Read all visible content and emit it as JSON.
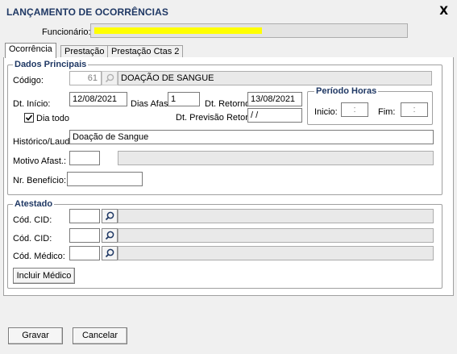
{
  "window": {
    "title": "LANÇAMENTO DE OCORRÊNCIAS",
    "close_label": "X"
  },
  "header": {
    "funcionario_label": "Funcionário:",
    "funcionario_value": ""
  },
  "tabs": [
    {
      "label": "Ocorrência",
      "active": true
    },
    {
      "label": "Prestação Ctas",
      "active": false
    },
    {
      "label": "Prestação Ctas 2",
      "active": false
    }
  ],
  "dados_principais": {
    "title": "Dados Principais",
    "codigo_label": "Código:",
    "codigo_value": "61",
    "codigo_desc": "DOAÇÃO DE SANGUE",
    "dt_inicio_label": "Dt. Início:",
    "dt_inicio_value": "12/08/2021",
    "dias_afast_label": "Dias Afast.",
    "dias_afast_value": "1",
    "dt_retorno_label": "Dt. Retorno:",
    "dt_retorno_value": "13/08/2021",
    "dia_todo_label": "Dia todo",
    "dia_todo_checked": true,
    "dt_prev_retorno_label": "Dt. Previsão Retorno:",
    "dt_prev_retorno_value": " / /",
    "historico_label": "Histórico/Laudo:",
    "historico_value": "Doação de Sangue",
    "motivo_label": "Motivo Afast.:",
    "motivo_value": "",
    "motivo_desc": "",
    "nr_beneficio_label": "Nr. Benefício:",
    "nr_beneficio_value": ""
  },
  "periodo_horas": {
    "title": "Período Horas",
    "inicio_label": "Inicio:",
    "inicio_value": ":",
    "fim_label": "Fim:",
    "fim_value": ":"
  },
  "atestado": {
    "title": "Atestado",
    "cid1_label": "Cód. CID:",
    "cid2_label": "Cód. CID:",
    "medico_label": "Cód. Médico:",
    "incluir_medico_label": "Incluir Médico"
  },
  "footer": {
    "gravar_label": "Gravar",
    "cancelar_label": "Cancelar"
  },
  "colors": {
    "title": "#1f3864",
    "highlight": "#ffff00"
  }
}
